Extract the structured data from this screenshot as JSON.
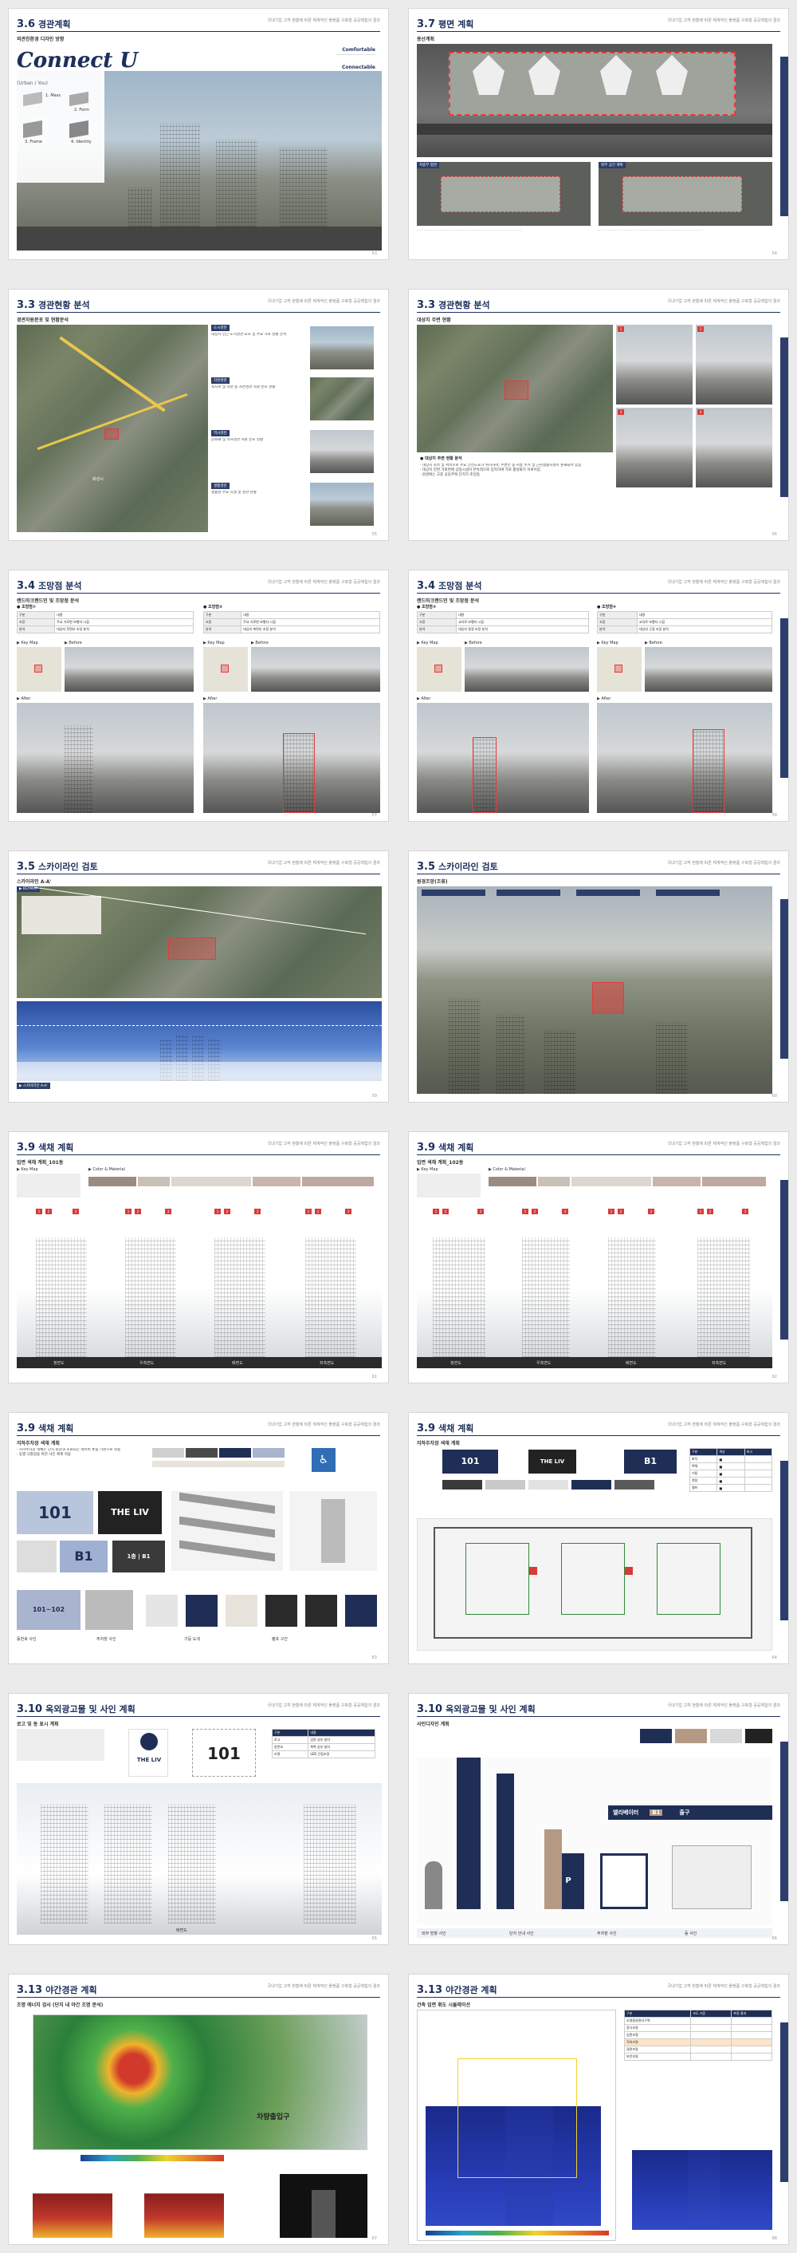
{
  "project_header": "국내기업 고객 현황에 따른 체계적인 플랫폼 구축형 공공체험의 결과",
  "pages": [
    {
      "num": "3.6",
      "title": "경관계획",
      "sub": "외관친환경 디자인 방향",
      "page_no": "53",
      "concept_title": "Connect U",
      "concept_sub": "(Urban / You)",
      "labels": [
        "Comfortable",
        "Connectable"
      ],
      "steps": [
        "1. Mass",
        "2. Form",
        "3. Frame",
        "4. Identity"
      ]
    },
    {
      "num": "3.7",
      "title": "평면 계획",
      "sub": "증산계획",
      "page_no": "54",
      "panels": [
        "저층부 평면",
        "외부 공간 계획"
      ]
    },
    {
      "num": "3.3",
      "title": "경관현황 분석",
      "sub": "경관자원분포 및 현황분석",
      "page_no": "55",
      "map_label": "화성시",
      "cards": [
        "도시경관",
        "자연경관",
        "역사경관",
        "생활경관"
      ]
    },
    {
      "num": "3.3",
      "title": "경관현황 분석",
      "sub": "대상지 주변 현황",
      "page_no": "56",
      "photo_nums": [
        "1",
        "2",
        "3",
        "4"
      ],
      "caption": "● 대상지 주변 현황 분석"
    },
    {
      "num": "3.4",
      "title": "조망점 분석",
      "sub": "랜드마크랜드인 및 조망점 분석",
      "page_no": "57",
      "views": [
        "● 조망점①",
        "● 조망점②"
      ],
      "cols": [
        "▶ Key Map",
        "▶ Before",
        "▶ After"
      ]
    },
    {
      "num": "3.4",
      "title": "조망점 분석",
      "sub": "랜드마크랜드인 및 조망점 분석",
      "page_no": "58",
      "views": [
        "● 조망점③",
        "● 조망점④"
      ],
      "cols": [
        "▶ Key Map",
        "▶ Before",
        "▶ After"
      ]
    },
    {
      "num": "3.5",
      "title": "스카이라인 검토",
      "sub": "스카이라인 A-A'",
      "page_no": "59",
      "tags": [
        "▶ KEYMAP",
        "▶ 스카이라인 A-A'"
      ]
    },
    {
      "num": "3.5",
      "title": "스카이라인 검토",
      "sub": "원경조망(조류)",
      "page_no": "60"
    },
    {
      "num": "3.9",
      "title": "색채 계획",
      "sub": "입면 색채 계획_101동",
      "page_no": "61",
      "key": [
        "▶ Key Map",
        "▶ Color & Material"
      ],
      "elevations": [
        "정면도",
        "우측면도",
        "배면도",
        "좌측면도"
      ]
    },
    {
      "num": "3.9",
      "title": "색채 계획",
      "sub": "입면 색채 계획_102동",
      "page_no": "62",
      "key": [
        "▶ Key Map",
        "▶ Color & Material"
      ],
      "elevations": [
        "정면도",
        "우측면도",
        "배면도",
        "좌측면도"
      ]
    },
    {
      "num": "3.9",
      "title": "색채 계획",
      "sub": "지하주차장 색채 계획",
      "page_no": "63",
      "signs": [
        "101",
        "THE LIV",
        "B1",
        "101~102",
        "1층 | B1"
      ],
      "legend": [
        "동번호 사인",
        "주차장 사인",
        "기둥 도색",
        "램프 구간"
      ]
    },
    {
      "num": "3.9",
      "title": "색채 계획",
      "sub": "지하주차장 색채 계획",
      "page_no": "64",
      "signs": [
        "101",
        "THE LIV",
        "B1"
      ],
      "table_head": [
        "구분",
        "색상",
        "비고"
      ]
    },
    {
      "num": "3.10",
      "title": "옥외광고물 및 사인 계획",
      "sub": "로고 및 동 표시 계획",
      "page_no": "65",
      "logo": "THE LIV",
      "dong": "101",
      "bottom_label": "배면도"
    },
    {
      "num": "3.10",
      "title": "옥외광고물 및 사인 계획",
      "sub": "사인디자인 계획",
      "page_no": "66",
      "signs": [
        "엘리베이터",
        "B1",
        "P",
        "출구"
      ],
      "legend": [
        "외부 방향 사인",
        "단지 안내 사인",
        "주차장 사인",
        "동 사인"
      ]
    },
    {
      "num": "3.13",
      "title": "야간경관 계획",
      "sub": "조명 에너지 검사 (단지 내 야간 조명 분석)",
      "page_no": "67",
      "labels": [
        "차량출입구"
      ]
    },
    {
      "num": "3.13",
      "title": "야간경관 계획",
      "sub": "건축 입면 휘도 시뮬레이션",
      "page_no": "68",
      "table_head": [
        "구분",
        "조도 기준",
        "측정 결과"
      ]
    }
  ]
}
